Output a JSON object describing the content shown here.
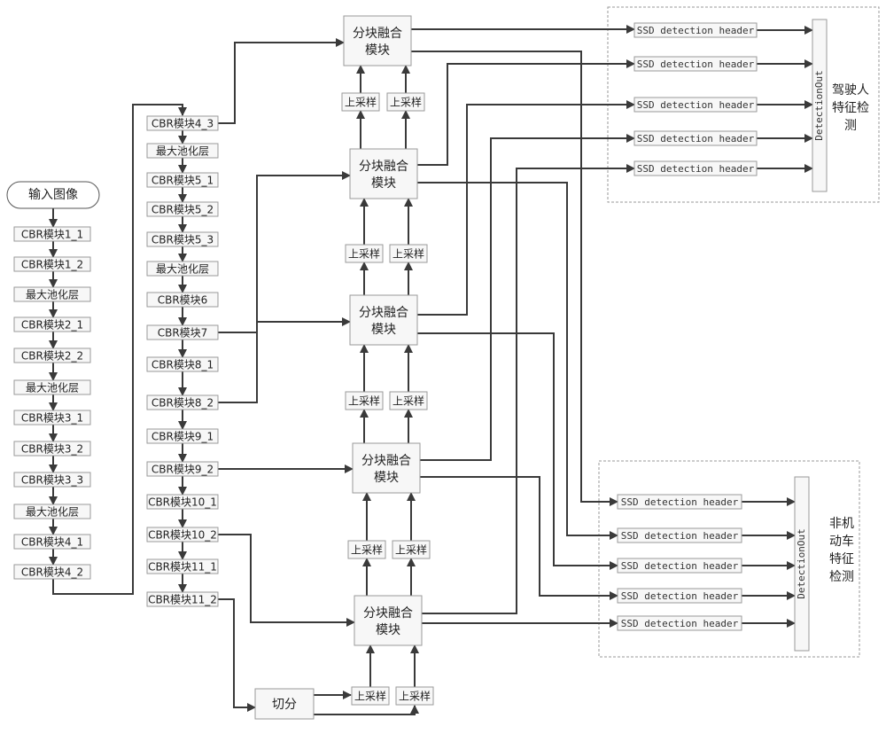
{
  "input": {
    "label": "输入图像"
  },
  "column1": [
    "CBR模块1_1",
    "CBR模块1_2",
    "最大池化层",
    "CBR模块2_1",
    "CBR模块2_2",
    "最大池化层",
    "CBR模块3_1",
    "CBR模块3_2",
    "CBR模块3_3",
    "最大池化层",
    "CBR模块4_1",
    "CBR模块4_2"
  ],
  "column2": [
    "CBR模块4_3",
    "最大池化层",
    "CBR模块5_1",
    "CBR模块5_2",
    "CBR模块5_3",
    "最大池化层",
    "CBR模块6",
    "CBR模块7",
    "CBR模块8_1",
    "CBR模块8_2",
    "CBR模块9_1",
    "CBR模块9_2",
    "CBR模块10_1",
    "CBR模块10_2",
    "CBR模块11_1",
    "CBR模块11_2"
  ],
  "fusion": {
    "label_line1": "分块融合",
    "label_line2": "模块",
    "count": 5
  },
  "upsample": {
    "label": "上采样"
  },
  "split": {
    "label": "切分"
  },
  "groups": [
    {
      "name": "driver",
      "title_lines": [
        "驾驶人",
        "特征检",
        "测"
      ],
      "headers": [
        "SSD detection header",
        "SSD detection header",
        "SSD detection header",
        "SSD detection header",
        "SSD detection header"
      ],
      "collector": "DetectionOut"
    },
    {
      "name": "non-motor",
      "title_lines": [
        "非机",
        "动车",
        "特征",
        "检测"
      ],
      "headers": [
        "SSD detection header",
        "SSD detection header",
        "SSD detection header",
        "SSD detection header",
        "SSD detection header"
      ],
      "collector": "DetectionOut"
    }
  ],
  "colors": {
    "line": "#3a3a3a",
    "box_fill": "#f7f7f7",
    "box_stroke": "#9a9a9a"
  }
}
